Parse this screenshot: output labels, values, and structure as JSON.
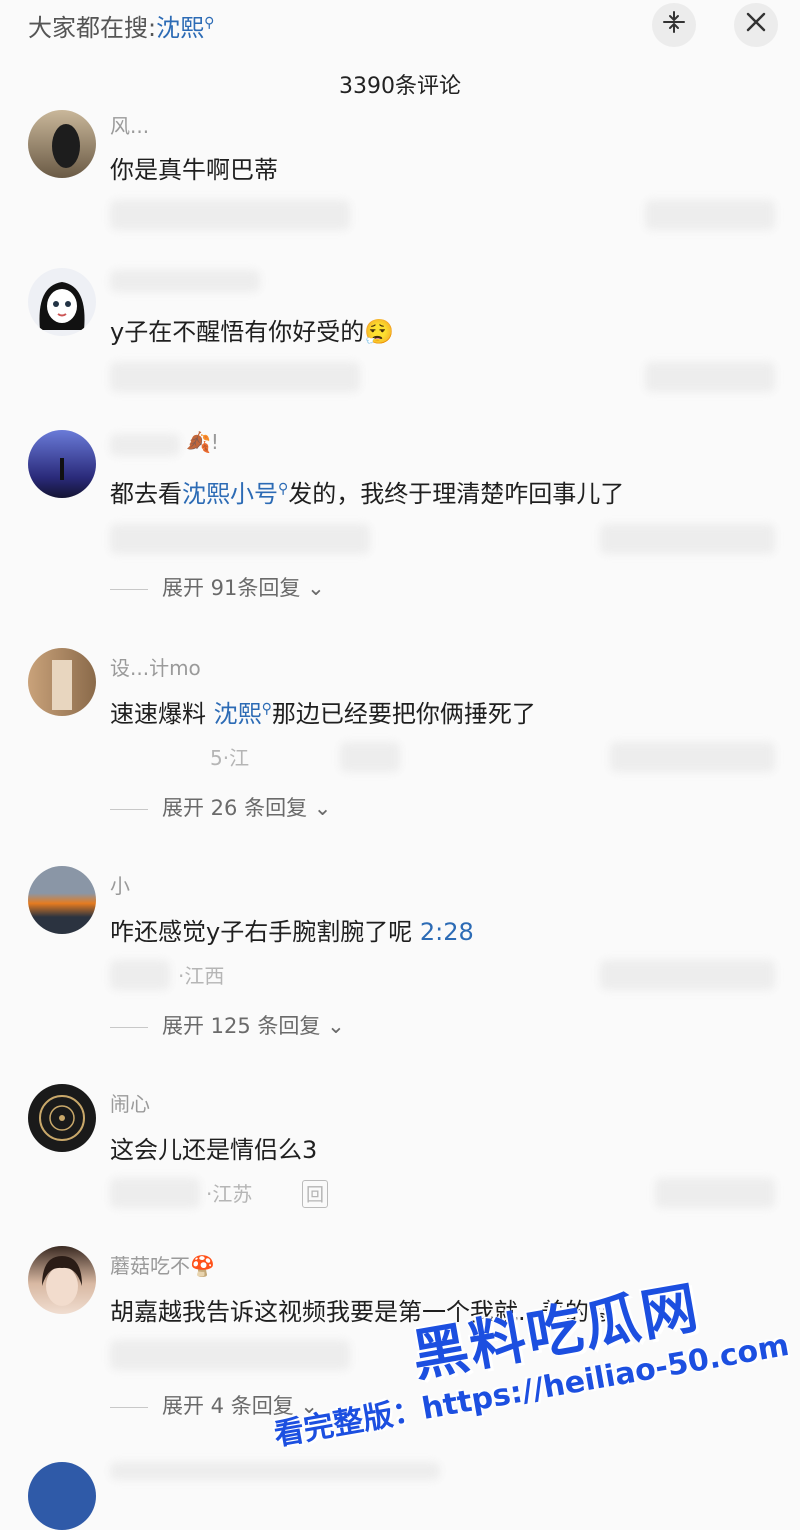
{
  "header": {
    "search_prefix": "大家都在搜:",
    "search_keyword": "沈熙",
    "search_icon": "search-icon",
    "collapse_icon": "collapse-icon",
    "close_icon": "close-icon",
    "comment_count_title": "3390条评论"
  },
  "comments": [
    {
      "username": "风...",
      "text": "你是真牛啊巴蒂"
    },
    {
      "username": "",
      "text": "y子在不醒悟有你好受的",
      "emoji": "😮‍💨"
    },
    {
      "username": "!",
      "text_before": "都去看",
      "link": "沈熙小号",
      "text_after": "发的，我终于理清楚咋回事儿了",
      "expand": "展开 91条回复"
    },
    {
      "username": "设...计mo",
      "text_before": "速速爆料 ",
      "link": "沈熙",
      "text_after": "那边已经要把你俩捶死了",
      "meta": "5·江",
      "expand": "展开 26 条回复"
    },
    {
      "username": "小",
      "text": "咋还感觉y子右手腕割腕了呢",
      "timestamp": "2:28",
      "meta": "·江西",
      "expand": "展开 125 条回复"
    },
    {
      "username": "闹心",
      "text": "这会儿还是情侣么3",
      "meta": "·江苏",
      "reply_icon": "回"
    },
    {
      "username": "蘑菇吃不",
      "username_emoji": "🍄",
      "text": "胡嘉越我告诉这视频我要是第一个我就...养的",
      "emoji": "😡",
      "expand": "展开 4 条回复"
    }
  ],
  "watermark": {
    "brand": "黑料吃瓜网",
    "line": "看完整版：https://heiliao-50.com"
  }
}
